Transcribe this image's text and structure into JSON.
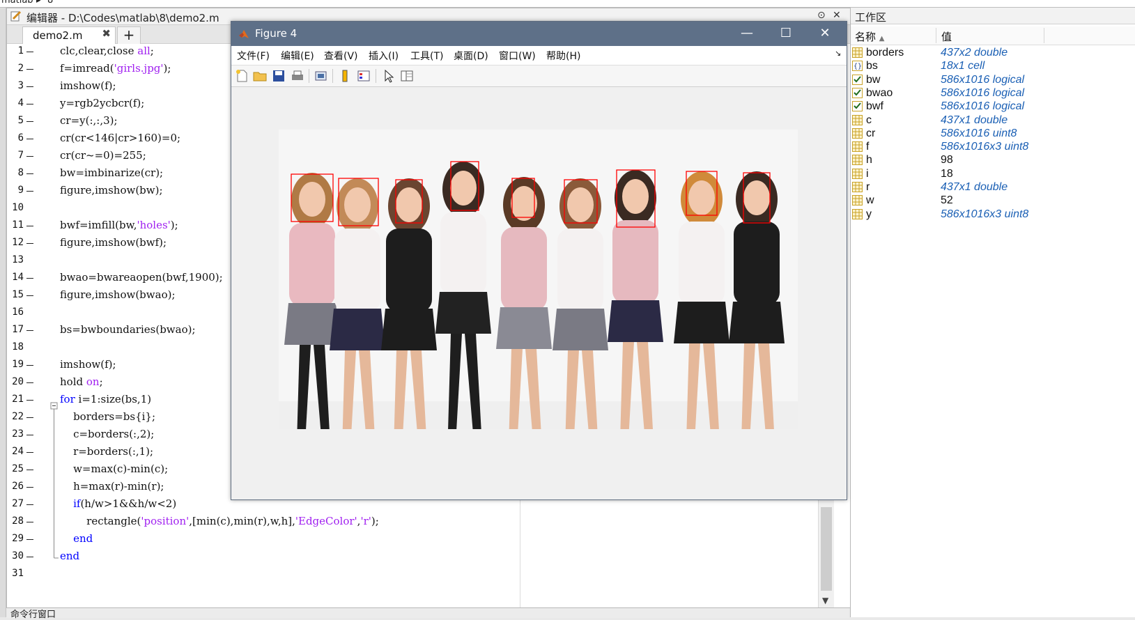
{
  "breadcrumb": [
    "matlab",
    "8"
  ],
  "editor": {
    "title": "编辑器 - D:\\Codes\\matlab\\8\\demo2.m",
    "tab_label": "demo2.m",
    "tab_close": "✖",
    "add_tab": "+",
    "line_numbers": [
      "1",
      "2",
      "3",
      "4",
      "5",
      "6",
      "7",
      "8",
      "9",
      "10",
      "11",
      "12",
      "13",
      "14",
      "15",
      "16",
      "17",
      "18",
      "19",
      "20",
      "21",
      "22",
      "23",
      "24",
      "25",
      "26",
      "27",
      "28",
      "29",
      "30",
      "31"
    ],
    "code_lines": [
      [
        {
          "t": "clc,clear,close "
        },
        {
          "t": "all",
          "c": "#a020f0"
        },
        {
          "t": ";"
        }
      ],
      [
        {
          "t": "f=imread("
        },
        {
          "t": "'girls.jpg'",
          "c": "#a020f0"
        },
        {
          "t": ");"
        }
      ],
      [
        {
          "t": "imshow(f);"
        }
      ],
      [
        {
          "t": "y=rgb2ycbcr(f);"
        }
      ],
      [
        {
          "t": "cr=y(:,:,3);"
        }
      ],
      [
        {
          "t": "cr(cr<146|cr>160)=0;"
        }
      ],
      [
        {
          "t": "cr(cr~=0)=255;"
        }
      ],
      [
        {
          "t": "bw=imbinarize(cr);"
        }
      ],
      [
        {
          "t": "figure,imshow(bw);"
        }
      ],
      [],
      [
        {
          "t": "bwf=imfill(bw,"
        },
        {
          "t": "'holes'",
          "c": "#a020f0"
        },
        {
          "t": ");"
        }
      ],
      [
        {
          "t": "figure,imshow(bwf);"
        }
      ],
      [],
      [
        {
          "t": "bwao=bwareaopen(bwf,1900);"
        }
      ],
      [
        {
          "t": "figure,imshow(bwao);"
        }
      ],
      [],
      [
        {
          "t": "bs=bwboundaries(bwao);"
        }
      ],
      [],
      [
        {
          "t": "imshow(f);"
        }
      ],
      [
        {
          "t": "hold "
        },
        {
          "t": "on",
          "c": "#a020f0"
        },
        {
          "t": ";"
        }
      ],
      [
        {
          "t": "for",
          "c": "#0000ff"
        },
        {
          "t": " i=1:size(bs,1)"
        }
      ],
      [
        {
          "t": "    borders=bs{i};"
        }
      ],
      [
        {
          "t": "    c=borders(:,2);"
        }
      ],
      [
        {
          "t": "    r=borders(:,1);"
        }
      ],
      [
        {
          "t": "    w=max(c)-min(c);"
        }
      ],
      [
        {
          "t": "    h=max(r)-min(r);"
        }
      ],
      [
        {
          "t": "    "
        },
        {
          "t": "if",
          "c": "#0000ff"
        },
        {
          "t": "(h/w>1&&h/w<2)"
        }
      ],
      [
        {
          "t": "        rectangle("
        },
        {
          "t": "'position'",
          "c": "#a020f0"
        },
        {
          "t": ",[min(c),min(r),w,h],"
        },
        {
          "t": "'EdgeColor'",
          "c": "#a020f0"
        },
        {
          "t": ","
        },
        {
          "t": "'r'",
          "c": "#a020f0"
        },
        {
          "t": ");"
        }
      ],
      [
        {
          "t": "    "
        },
        {
          "t": "end",
          "c": "#0000ff"
        }
      ],
      [
        {
          "t": "end",
          "c": "#0000ff"
        }
      ],
      []
    ]
  },
  "command_window": {
    "title": "命令行窗口"
  },
  "workspace": {
    "title": "工作区",
    "col_name": "名称",
    "col_value": "值",
    "variables": [
      {
        "name": "borders",
        "value": "437x2 double",
        "icon": "matrix-icon",
        "italic": true
      },
      {
        "name": "bs",
        "value": "18x1 cell",
        "icon": "cell-icon",
        "italic": true
      },
      {
        "name": "bw",
        "value": "586x1016 logical",
        "icon": "logical-icon",
        "italic": true
      },
      {
        "name": "bwao",
        "value": "586x1016 logical",
        "icon": "logical-icon",
        "italic": true
      },
      {
        "name": "bwf",
        "value": "586x1016 logical",
        "icon": "logical-icon",
        "italic": true
      },
      {
        "name": "c",
        "value": "437x1 double",
        "icon": "matrix-icon",
        "italic": true
      },
      {
        "name": "cr",
        "value": "586x1016 uint8",
        "icon": "matrix-icon",
        "italic": true
      },
      {
        "name": "f",
        "value": "586x1016x3 uint8",
        "icon": "matrix-icon",
        "italic": true
      },
      {
        "name": "h",
        "value": "98",
        "icon": "matrix-icon",
        "italic": false
      },
      {
        "name": "i",
        "value": "18",
        "icon": "matrix-icon",
        "italic": false
      },
      {
        "name": "r",
        "value": "437x1 double",
        "icon": "matrix-icon",
        "italic": true
      },
      {
        "name": "w",
        "value": "52",
        "icon": "matrix-icon",
        "italic": false
      },
      {
        "name": "y",
        "value": "586x1016x3 uint8",
        "icon": "matrix-icon",
        "italic": true
      }
    ]
  },
  "figure": {
    "title": "Figure 4",
    "minimize": "—",
    "maximize": "☐",
    "close": "✕",
    "menu": [
      "文件(F)",
      "编辑(E)",
      "查看(V)",
      "插入(I)",
      "工具(T)",
      "桌面(D)",
      "窗口(W)",
      "帮助(H)"
    ],
    "toolbar": [
      "new-figure-icon",
      "open-folder-icon",
      "save-icon",
      "print-icon",
      "link-plot-icon",
      "colorbar-icon",
      "legend-icon",
      "pointer-icon",
      "property-inspector-icon"
    ],
    "image_description_colors": {
      "face_box": "#ff0000",
      "background": "#f5f5f5"
    },
    "detected_face_count": 9
  },
  "colors": {
    "keyword": "#0000ff",
    "string": "#a020f0",
    "title_bar": "#5e7088",
    "var_value": "#1a5fb4"
  }
}
